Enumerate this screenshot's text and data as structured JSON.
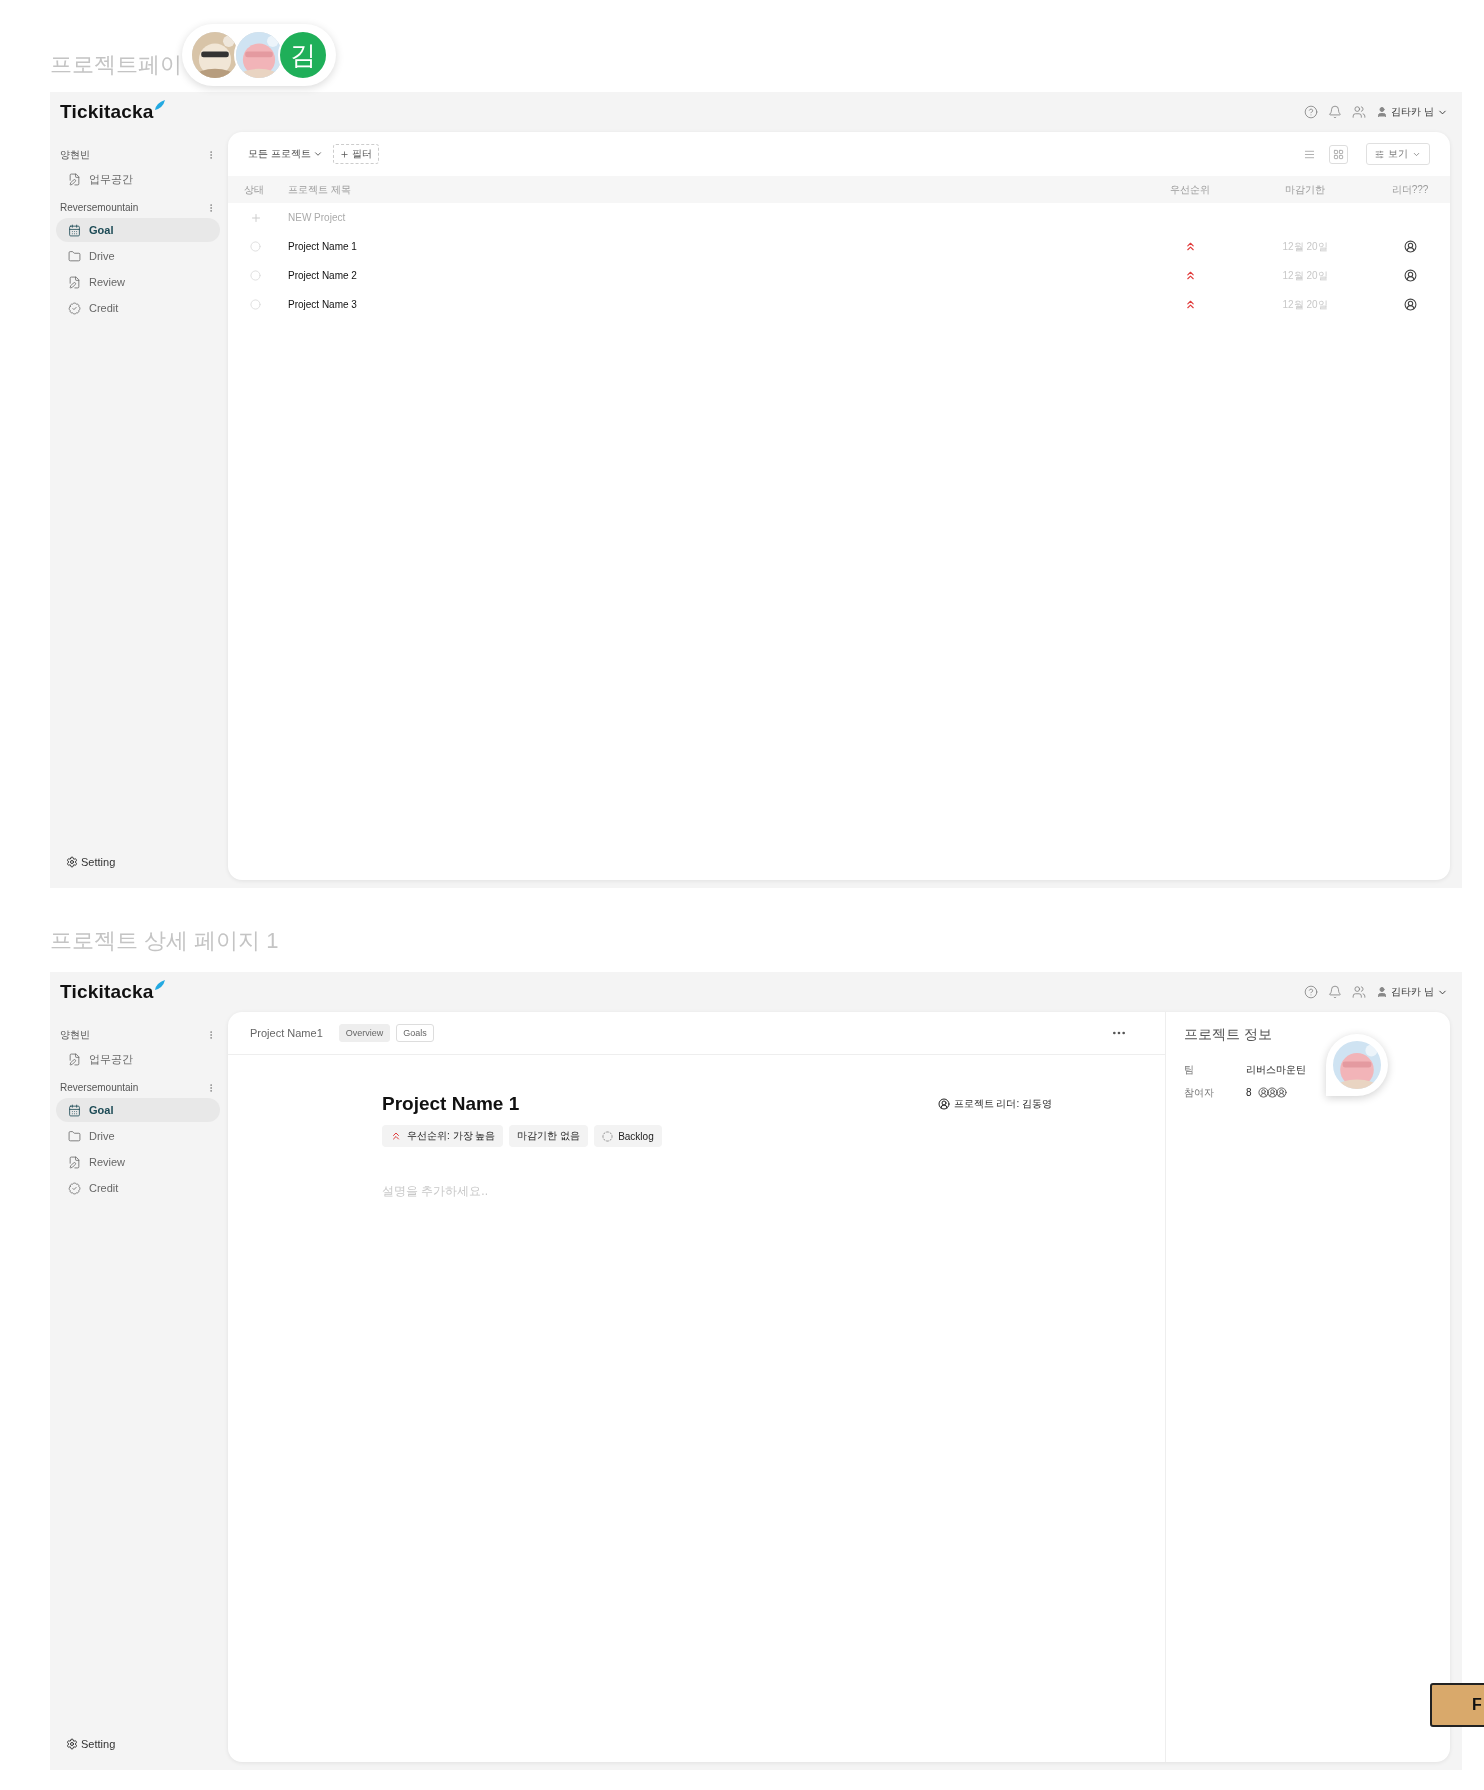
{
  "presence_avatars": [
    {
      "kind": "picture"
    },
    {
      "kind": "picture"
    },
    {
      "kind": "initial",
      "initial": "김",
      "color": "#1faf59"
    }
  ],
  "frames": [
    {
      "kind": "list",
      "title": "프로젝트페이",
      "logo": "Tickitacka",
      "user": "김타카 님",
      "sidebar": [
        {
          "label": "양현빈",
          "items": [
            {
              "label": "업무공간",
              "selected": false
            }
          ]
        },
        {
          "label": "Reversemountain",
          "items": [
            {
              "label": "Goal",
              "selected": true
            },
            {
              "label": "Drive",
              "selected": false
            },
            {
              "label": "Review",
              "selected": false
            },
            {
              "label": "Credit",
              "selected": false
            }
          ]
        }
      ],
      "setting": "Setting",
      "list": {
        "scope": "모든 프로젝트",
        "filter": "필터",
        "views": [
          {
            "kind": "list",
            "selected": false
          },
          {
            "kind": "grid",
            "selected": true
          }
        ],
        "view_button": "보기",
        "columns": [
          "상태",
          "프로젝트 제목",
          "우선순위",
          "마감기한",
          "리더???"
        ],
        "new_row": "NEW Project",
        "rows": [
          {
            "name": "Project Name 1",
            "due": "12월 20일"
          },
          {
            "name": "Project Name 2",
            "due": "12월 20일"
          },
          {
            "name": "Project Name 3",
            "due": "12월 20일"
          }
        ]
      }
    },
    {
      "kind": "detail",
      "title": "프로젝트 상세 페이지 1",
      "logo": "Tickitacka",
      "user": "김타카 님",
      "sidebar": [
        {
          "label": "양현빈",
          "items": [
            {
              "label": "업무공간",
              "selected": false
            }
          ]
        },
        {
          "label": "Reversemountain",
          "items": [
            {
              "label": "Goal",
              "selected": true
            },
            {
              "label": "Drive",
              "selected": false
            },
            {
              "label": "Review",
              "selected": false
            },
            {
              "label": "Credit",
              "selected": false
            }
          ]
        }
      ],
      "setting": "Setting",
      "detail": {
        "breadcrumb": "Project Name1",
        "tabs": [
          {
            "label": "Overview",
            "selected": true
          },
          {
            "label": "Goals",
            "selected": false
          }
        ],
        "heading": "Project Name 1",
        "leader": "프로젝트 리더: 김동영",
        "tags": [
          {
            "kind": "priority",
            "label": "우선순위: 가장 높음"
          },
          {
            "kind": "plain",
            "label": "마감기한 없음"
          },
          {
            "kind": "status",
            "label": "Backlog"
          }
        ],
        "description_placeholder": "설명을 추가하세요..",
        "info": {
          "title": "프로젝트 정보",
          "fields": [
            {
              "kind": "text",
              "label": "팀",
              "value": "리버스마운틴"
            },
            {
              "kind": "people",
              "label": "참여자",
              "value": "8"
            }
          ]
        }
      }
    }
  ],
  "sign": {
    "text": "F"
  }
}
